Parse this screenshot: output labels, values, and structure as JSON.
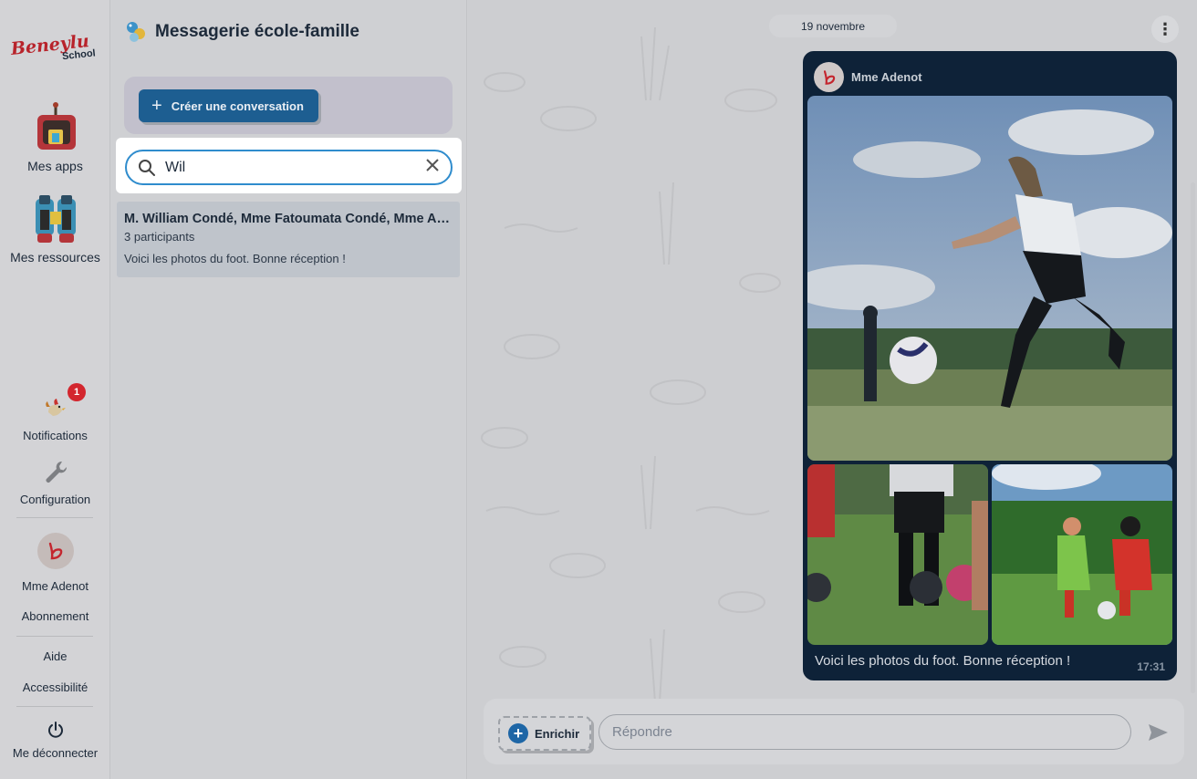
{
  "nav": {
    "logo_text": "Beneylu",
    "logo_sub": "School",
    "apps_label": "Mes apps",
    "resources_label": "Mes ressources",
    "notifications_label": "Notifications",
    "notifications_count": "1",
    "configuration_label": "Configuration",
    "user_label": "Mme Adenot",
    "subscription_label": "Abonnement",
    "help_label": "Aide",
    "accessibility_label": "Accessibilité",
    "logout_label": "Me déconnecter"
  },
  "list": {
    "title": "Messagerie école-famille",
    "create_label": "Créer une conversation",
    "search_value": "Wil",
    "conversations": [
      {
        "title": "M. William Condé, Mme Fatoumata Condé, Mme Adenot",
        "participants": "3 participants",
        "last_message": "Voici les photos du foot. Bonne réception !"
      }
    ]
  },
  "chat": {
    "date": "19 novembre",
    "message": {
      "author": "Mme Adenot",
      "text": "Voici les photos du foot. Bonne réception !",
      "time": "17:31"
    },
    "composer": {
      "enrich_label": "Enrichir",
      "reply_placeholder": "Répondre"
    }
  },
  "colors": {
    "accent": "#2f8ccd",
    "primary_button": "#1d5e91",
    "message_bg": "#0e2238",
    "badge": "#d3262e"
  }
}
